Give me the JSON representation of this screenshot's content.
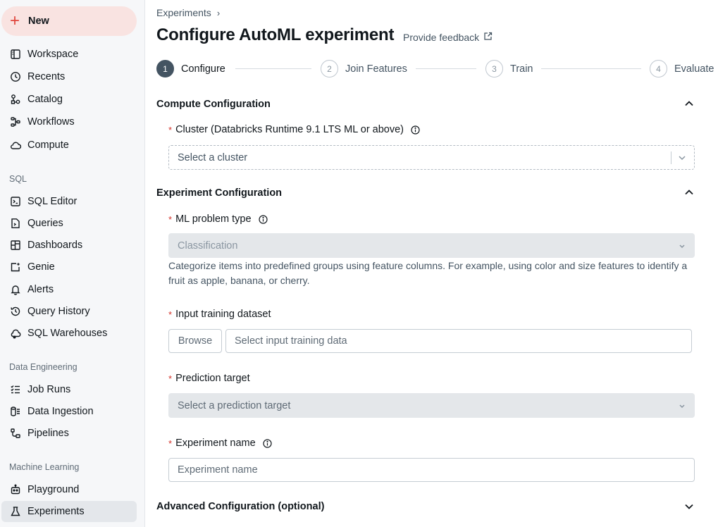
{
  "sidebar": {
    "new_label": "New",
    "items_top": [
      {
        "label": "Workspace",
        "icon": "workspace-icon"
      },
      {
        "label": "Recents",
        "icon": "clock-icon"
      },
      {
        "label": "Catalog",
        "icon": "catalog-icon"
      },
      {
        "label": "Workflows",
        "icon": "workflows-icon"
      },
      {
        "label": "Compute",
        "icon": "cloud-icon"
      }
    ],
    "sql_section": "SQL",
    "items_sql": [
      {
        "label": "SQL Editor",
        "icon": "sql-editor-icon"
      },
      {
        "label": "Queries",
        "icon": "queries-icon"
      },
      {
        "label": "Dashboards",
        "icon": "dashboards-icon"
      },
      {
        "label": "Genie",
        "icon": "genie-icon"
      },
      {
        "label": "Alerts",
        "icon": "bell-icon"
      },
      {
        "label": "Query History",
        "icon": "history-icon"
      },
      {
        "label": "SQL Warehouses",
        "icon": "warehouse-icon"
      }
    ],
    "de_section": "Data Engineering",
    "items_de": [
      {
        "label": "Job Runs",
        "icon": "job-runs-icon"
      },
      {
        "label": "Data Ingestion",
        "icon": "ingestion-icon"
      },
      {
        "label": "Pipelines",
        "icon": "pipelines-icon"
      }
    ],
    "ml_section": "Machine Learning",
    "items_ml": [
      {
        "label": "Playground",
        "icon": "robot-icon"
      },
      {
        "label": "Experiments",
        "icon": "flask-icon"
      }
    ]
  },
  "header": {
    "breadcrumb": "Experiments",
    "title": "Configure AutoML experiment",
    "feedback": "Provide feedback"
  },
  "stepper": [
    {
      "num": "1",
      "label": "Configure"
    },
    {
      "num": "2",
      "label": "Join Features"
    },
    {
      "num": "3",
      "label": "Train"
    },
    {
      "num": "4",
      "label": "Evaluate"
    }
  ],
  "compute": {
    "title": "Compute Configuration",
    "cluster_label": "Cluster (Databricks Runtime 9.1 LTS ML or above)",
    "cluster_placeholder": "Select a cluster"
  },
  "experiment": {
    "title": "Experiment Configuration",
    "problem_type_label": "ML problem type",
    "problem_type_value": "Classification",
    "problem_desc": "Categorize items into predefined groups using feature columns. For example, using color and size features to identify a fruit as apple, banana, or cherry.",
    "dataset_label": "Input training dataset",
    "browse_label": "Browse",
    "dataset_placeholder": "Select input training data",
    "target_label": "Prediction target",
    "target_placeholder": "Select a prediction target",
    "name_label": "Experiment name",
    "name_placeholder": "Experiment name"
  },
  "advanced": {
    "title": "Advanced Configuration (optional)"
  },
  "colors": {
    "accent_red": "#e0463d",
    "required": "#d4332b",
    "text_primary": "#11171c",
    "text_secondary": "#445462"
  }
}
